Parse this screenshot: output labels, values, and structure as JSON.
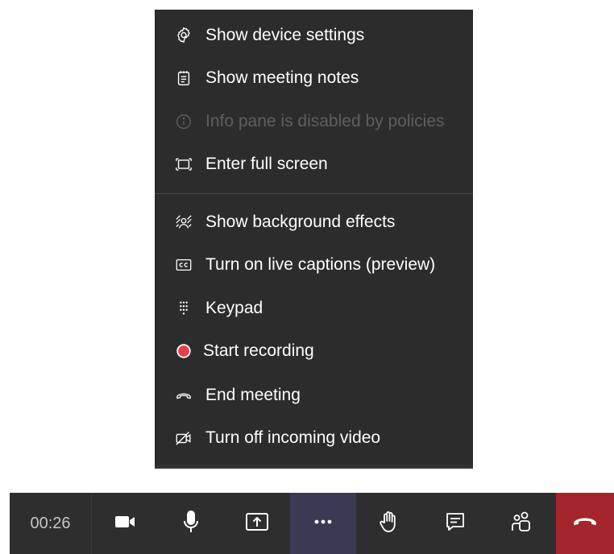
{
  "menu": {
    "items": [
      {
        "label": "Show device settings",
        "icon": "gear-icon",
        "enabled": true
      },
      {
        "label": "Show meeting notes",
        "icon": "notes-icon",
        "enabled": true
      },
      {
        "label": "Info pane is disabled by policies",
        "icon": "info-icon",
        "enabled": false
      },
      {
        "label": "Enter full screen",
        "icon": "fullscreen-icon",
        "enabled": true
      },
      {
        "label": "Show background effects",
        "icon": "background-effects-icon",
        "enabled": true
      },
      {
        "label": "Turn on live captions (preview)",
        "icon": "captions-icon",
        "enabled": true
      },
      {
        "label": "Keypad",
        "icon": "keypad-icon",
        "enabled": true
      },
      {
        "label": "Start recording",
        "icon": "record-icon",
        "enabled": true
      },
      {
        "label": "End meeting",
        "icon": "hangup-icon",
        "enabled": true
      },
      {
        "label": "Turn off incoming video",
        "icon": "video-off-icon",
        "enabled": true
      }
    ]
  },
  "toolbar": {
    "timer": "00:26",
    "buttons": [
      {
        "name": "camera",
        "icon": "video-camera-icon"
      },
      {
        "name": "microphone",
        "icon": "microphone-icon"
      },
      {
        "name": "share",
        "icon": "share-screen-icon"
      },
      {
        "name": "more-actions",
        "icon": "more-icon"
      },
      {
        "name": "raise-hand",
        "icon": "hand-icon"
      },
      {
        "name": "chat",
        "icon": "chat-icon"
      },
      {
        "name": "participants",
        "icon": "people-icon"
      },
      {
        "name": "leave",
        "icon": "hangup-icon"
      }
    ]
  },
  "colors": {
    "menu_bg": "#2d2c2c",
    "menu_text": "#ffffff",
    "disabled_text": "#5f5e5e",
    "toolbar_bg": "#2f2e2e",
    "more_active_bg": "#3b3a55",
    "leave_bg": "#a4262c",
    "record_red": "#e8404b"
  }
}
